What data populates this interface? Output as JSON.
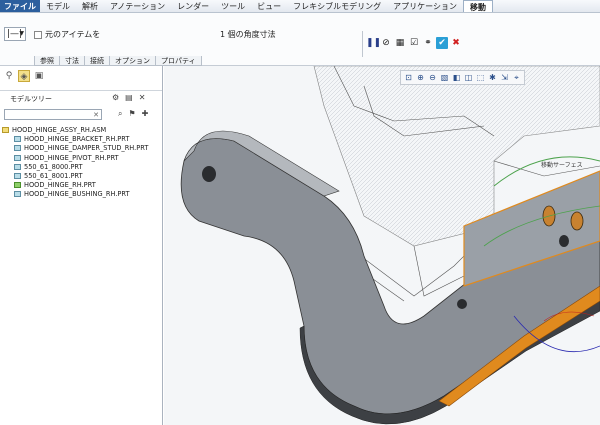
{
  "menu": {
    "file": "ファイル",
    "items": [
      "モデル",
      "解析",
      "アノテーション",
      "レンダー",
      "ツール",
      "ビュー",
      "フレキシブルモデリング",
      "アプリケーション",
      "移動"
    ],
    "active_index": 8
  },
  "ribbon": {
    "type_symbol": "|—|",
    "original_item_label": "元のアイテムを",
    "status": "1 個の角度寸法",
    "tabs": [
      "参照",
      "寸法",
      "接続",
      "オプション",
      "プロパティ"
    ]
  },
  "left_pane": {
    "tree_title": "モデルツリー",
    "items": [
      {
        "label": "HOOD_HINGE_ASSY_RH.ASM",
        "icon": "assembly-icon",
        "child": false
      },
      {
        "label": "HOOD_HINGE_BRACKET_RH.PRT",
        "icon": "part-icon",
        "child": true
      },
      {
        "label": "HOOD_HINGE_DAMPER_STUD_RH.PRT",
        "icon": "part-icon",
        "child": true
      },
      {
        "label": "HOOD_HINGE_PIVOT_RH.PRT",
        "icon": "part-icon",
        "child": true
      },
      {
        "label": "550_61_8000.PRT",
        "icon": "part-icon",
        "child": true
      },
      {
        "label": "550_61_8001.PRT",
        "icon": "part-icon",
        "child": true
      },
      {
        "label": "HOOD_HINGE_RH.PRT",
        "icon": "part-moving-icon",
        "child": true
      },
      {
        "label": "HOOD_HINGE_BUSHING_RH.PRT",
        "icon": "part-icon",
        "child": true
      }
    ]
  },
  "viewport": {
    "model_label": "移動サーフェス",
    "part_color": "#8a8f96",
    "highlight_color": "#e08a1e"
  }
}
